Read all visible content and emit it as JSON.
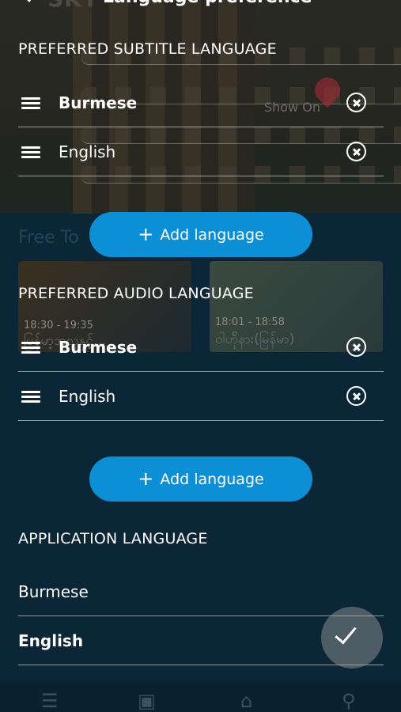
{
  "header": {
    "title": "Language preference",
    "logo_text": "SKY"
  },
  "background": {
    "show_on_label": "Show On",
    "section_label": "Free To",
    "cards": [
      {
        "time": "18:30 - 19:35",
        "title": "မြန်မာ့အလှနှင့်..."
      },
      {
        "time": "18:01 - 18:58",
        "title": "ဝါဟ်ိုနား(မြန်မာ)"
      }
    ]
  },
  "subtitle": {
    "heading": "PREFERRED SUBTITLE LANGUAGE",
    "languages": [
      {
        "label": "Burmese"
      },
      {
        "label": "English"
      }
    ],
    "add_label": "Add language"
  },
  "audio": {
    "heading": "PREFERRED AUDIO LANGUAGE",
    "languages": [
      {
        "label": "Burmese"
      },
      {
        "label": "English"
      }
    ],
    "add_label": "Add language"
  },
  "application": {
    "heading": "APPLICATION LANGUAGE",
    "options": [
      {
        "label": "Burmese",
        "selected": false
      },
      {
        "label": "English",
        "selected": true
      }
    ]
  },
  "icons": {
    "drag": "drag-handle-icon",
    "remove": "remove-circle-icon",
    "add": "plus-icon",
    "check": "check-icon"
  },
  "colors": {
    "accent": "#0d8fd6",
    "background": "#0a2433"
  }
}
